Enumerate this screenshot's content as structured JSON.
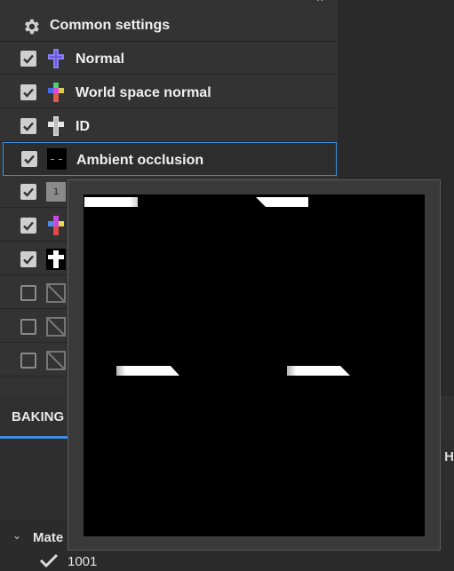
{
  "common_settings": {
    "label": "Common settings",
    "icon": "gear-icon"
  },
  "bakers": [
    {
      "label": "Normal",
      "checked": true,
      "icon": "normal-map-thumbnail"
    },
    {
      "label": "World space normal",
      "checked": true,
      "icon": "world-space-normal-thumbnail"
    },
    {
      "label": "ID",
      "checked": true,
      "icon": "id-map-thumbnail"
    },
    {
      "label": "Ambient occlusion",
      "checked": true,
      "icon": "ambient-occlusion-thumbnail",
      "selected": true
    },
    {
      "label": "1",
      "checked": true,
      "icon": "curvature-thumbnail"
    },
    {
      "label": "",
      "checked": true,
      "icon": "position-thumbnail"
    },
    {
      "label": "",
      "checked": true,
      "icon": "thickness-thumbnail"
    },
    {
      "label": "",
      "checked": false,
      "icon": "empty-thumbnail"
    },
    {
      "label": "",
      "checked": false,
      "icon": "empty-thumbnail"
    },
    {
      "label": "",
      "checked": false,
      "icon": "empty-thumbnail"
    }
  ],
  "tabs": {
    "baking": "BAKING",
    "right_cut": "H"
  },
  "materials": {
    "label": "Mate",
    "item": "1001"
  },
  "colors": {
    "accent": "#3c8fe0",
    "panel": "#333333",
    "checkbox": "#cfcfcf"
  }
}
